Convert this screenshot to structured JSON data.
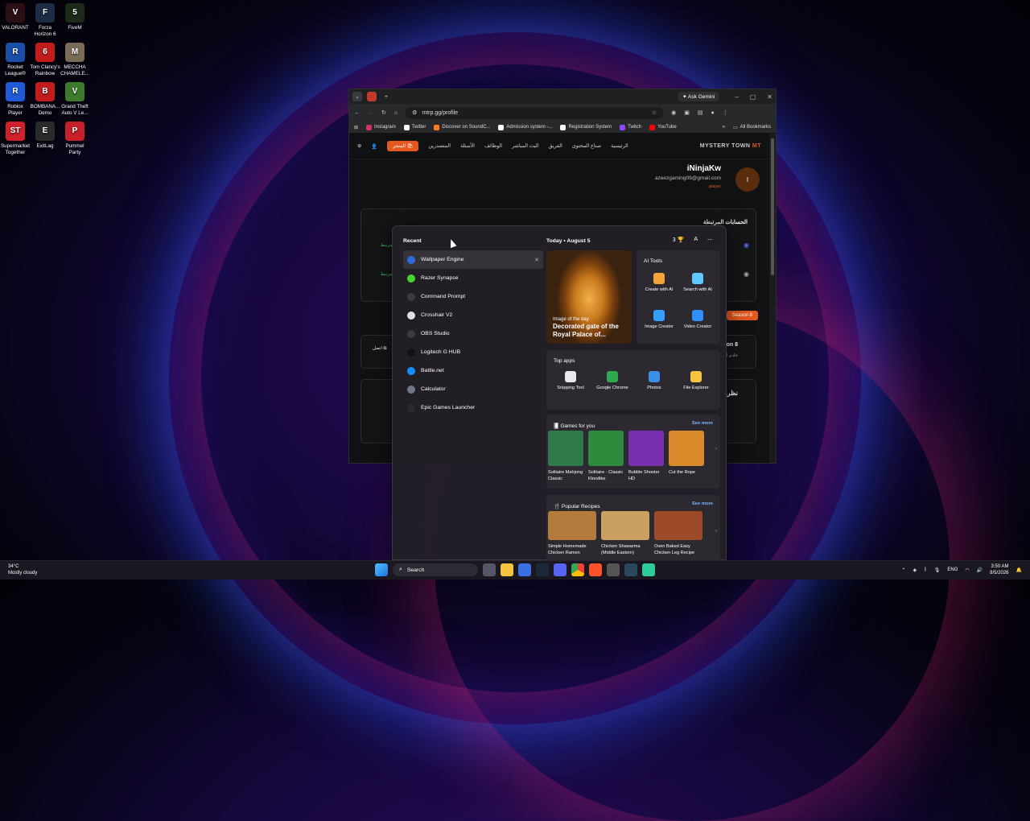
{
  "desktop": {
    "icons": [
      {
        "label": "VALORANT",
        "color": "#2b0f14",
        "glyph": "V"
      },
      {
        "label": "Forza Horizon 6",
        "color": "#1b2c44",
        "glyph": "F"
      },
      {
        "label": "FiveM",
        "color": "#1b2a1b",
        "glyph": "5"
      },
      {
        "label": "Rocket League®",
        "color": "#1a4fa8",
        "glyph": "R"
      },
      {
        "label": "Tom Clancy's Rainbow",
        "color": "#c21d1d",
        "glyph": "6"
      },
      {
        "label": "MECCHA CHAMELE...",
        "color": "#7b6a58",
        "glyph": "M"
      },
      {
        "label": "Roblox Player",
        "color": "#1f5bd8",
        "glyph": "R"
      },
      {
        "label": "BOMBANA... Demo",
        "color": "#c21d1d",
        "glyph": "B"
      },
      {
        "label": "Grand Theft Auto V Le...",
        "color": "#3d7a2c",
        "glyph": "V"
      },
      {
        "label": "Supermarket Together",
        "color": "#d0202a",
        "glyph": "ST"
      },
      {
        "label": "ExitLag",
        "color": "#2a2a2a",
        "glyph": "E"
      },
      {
        "label": "Pummel Party",
        "color": "#c8202a",
        "glyph": "P"
      }
    ]
  },
  "browser": {
    "ask_gemini": "Ask Gemini",
    "url": "mtrp.gg/profile",
    "bookmarks": [
      {
        "label": "Instagram",
        "color": "#d6336c"
      },
      {
        "label": "Twitter",
        "color": "#ffffff"
      },
      {
        "label": "Discover on SoundC...",
        "color": "#ff7a1a"
      },
      {
        "label": "Admission system -...",
        "color": "#ffffff"
      },
      {
        "label": "Registration System",
        "color": "#ffffff"
      },
      {
        "label": "Twitch",
        "color": "#9146ff"
      },
      {
        "label": "YouTube",
        "color": "#ff0000"
      }
    ],
    "all_bookmarks": "All Bookmarks",
    "site": {
      "nav": [
        "المتصدرين",
        "الأسئلة",
        "الوظائف",
        "البث المباشر",
        "الفريق",
        "صناع المحتوى",
        "الرئيسية"
      ],
      "shop_label": "المتجر",
      "logo": "MYSTERY TOWN",
      "logo_sub": "STUDIOS",
      "profile_name": "iNinjaKw",
      "profile_email": "azeezgaming09@gmail.com",
      "profile_role": "player",
      "linked_label": "مرتبط",
      "season_badge": "Season 8",
      "section_accounts": "الحسابات المرتبطة",
      "section_season": "Season 8",
      "section_server": "خادم لعب أ",
      "section_view": "نظرة",
      "action_label": "اتصل"
    }
  },
  "start_menu": {
    "recent_title": "Recent",
    "recent": [
      {
        "label": "Wallpaper Engine",
        "color": "#2f6ad9"
      },
      {
        "label": "Razer Synapse",
        "color": "#44d62c"
      },
      {
        "label": "Command Prompt",
        "color": "#3a3a3a"
      },
      {
        "label": "Crosshair V2",
        "color": "#e0e0e0"
      },
      {
        "label": "OBS Studio",
        "color": "#3b3b3b"
      },
      {
        "label": "Logitech G HUB",
        "color": "#111111"
      },
      {
        "label": "Battle.net",
        "color": "#148eff"
      },
      {
        "label": "Calculator",
        "color": "#6f7a86"
      },
      {
        "label": "Epic Games Launcher",
        "color": "#2b2b2b"
      }
    ],
    "today_label": "Today",
    "date_label": "August 5",
    "points": "3",
    "image_of_day_label": "Image of the day",
    "image_of_day_title": "Decorated gate of the Royal Palace of...",
    "ai_tools_title": "AI Tools",
    "ai_tools": [
      {
        "label": "Create with AI",
        "color": "#f3a33a"
      },
      {
        "label": "Search with AI",
        "color": "#5ec8ff"
      },
      {
        "label": "Image Creator",
        "color": "#35a0ff"
      },
      {
        "label": "Video Creator",
        "color": "#2f8fff"
      }
    ],
    "top_apps_title": "Top apps",
    "top_apps": [
      {
        "label": "Snipping Tool",
        "color": "#e8e8ee"
      },
      {
        "label": "Google Chrome",
        "color": "#2fa84f"
      },
      {
        "label": "Photos",
        "color": "#3a8fe8"
      },
      {
        "label": "File Explorer",
        "color": "#f5c542"
      }
    ],
    "games_title": "Games for you",
    "games": [
      {
        "label": "Solitaire Mahjong Classic",
        "color": "#2f7a4a"
      },
      {
        "label": "Solitaire - Classic Klondike",
        "color": "#2e8a3c"
      },
      {
        "label": "Bubble Shooter HD",
        "color": "#7a2fb0"
      },
      {
        "label": "Cut the Rope",
        "color": "#d98a2a"
      }
    ],
    "recipes_title": "Popular Recipes",
    "recipes": [
      {
        "label": "Simple Homemade Chicken Ramen",
        "color": "#b57b3c"
      },
      {
        "label": "Chicken Shawarma (Middle Eastern)",
        "color": "#c9a062"
      },
      {
        "label": "Oven Baked Easy Chicken Leg Recipe",
        "color": "#9c4a2a"
      }
    ],
    "see_more": "See more"
  },
  "taskbar": {
    "temperature": "34°C",
    "weather": "Mostly cloudy",
    "search_label": "Search",
    "language": "ENG",
    "time": "3:50 AM",
    "date": "8/5/2026"
  }
}
